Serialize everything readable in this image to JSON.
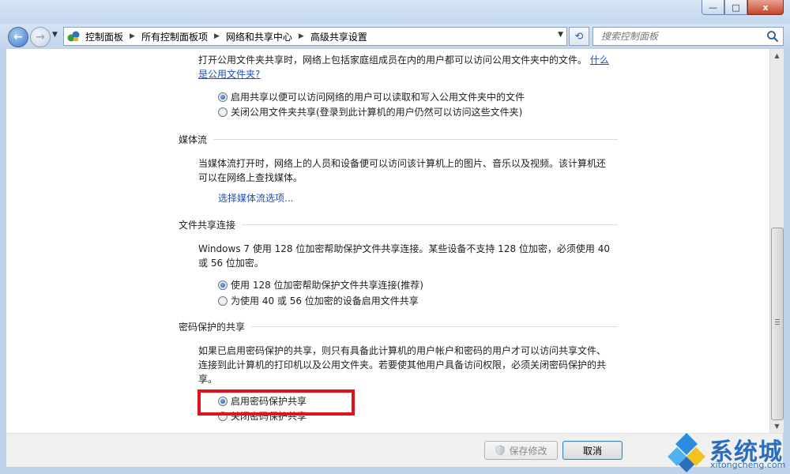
{
  "window": {
    "minimize": "—",
    "maximize": "□",
    "close": "x"
  },
  "nav": {
    "back": "←",
    "forward": "→",
    "history_drop": "▼"
  },
  "breadcrumbs": [
    "控制面板",
    "所有控制面板项",
    "网络和共享中心",
    "高级共享设置"
  ],
  "address_drop": "▼",
  "refresh": "⟲",
  "search": {
    "placeholder": "搜索控制面板"
  },
  "public_folder": {
    "description": "打开公用文件夹共享时，网络上包括家庭组成员在内的用户都可以访问公用文件夹中的文件。",
    "link_part1": "什么",
    "link_part2": "是公用文件夹?",
    "options": [
      {
        "label": "启用共享以便可以访问网络的用户可以读取和写入公用文件夹中的文件",
        "checked": true
      },
      {
        "label": "关闭公用文件夹共享(登录到此计算机的用户仍然可以访问这些文件夹)",
        "checked": false
      }
    ]
  },
  "media_streaming": {
    "heading": "媒体流",
    "line1": "当媒体流打开时，网络上的人员和设备便可以访问该计算机上的图片、音乐以及视频。该计算机还",
    "line2": "可以在网络上查找媒体。",
    "link": "选择媒体流选项..."
  },
  "file_sharing": {
    "heading": "文件共享连接",
    "line1": "Windows 7 使用 128 位加密帮助保护文件共享连接。某些设备不支持 128 位加密，必须使用 40",
    "line2": "或 56 位加密。",
    "options": [
      {
        "label": "使用 128 位加密帮助保护文件共享连接(推荐)",
        "checked": true
      },
      {
        "label": "为使用 40 或 56 位加密的设备启用文件共享",
        "checked": false
      }
    ]
  },
  "password_sharing": {
    "heading": "密码保护的共享",
    "line1": "如果已启用密码保护的共享，则只有具备此计算机的用户帐户和密码的用户才可以访问共享文件、",
    "line2": "连接到此计算机的打印机以及公用文件夹。若要使其他用户具备访问权限，必须关闭密码保护的共",
    "line3": "享。",
    "options": [
      {
        "label": "启用密码保护共享",
        "checked": true
      },
      {
        "label": "关闭密码保护共享",
        "checked": false
      }
    ]
  },
  "footer": {
    "save_label": "保存修改",
    "cancel_label": "取消"
  },
  "watermark": {
    "title": "系统城",
    "url": "xitongcheng.com"
  },
  "colors": {
    "highlight": "#e3111b",
    "link": "#1f4fbf",
    "watermark": "#2a6ebd"
  }
}
